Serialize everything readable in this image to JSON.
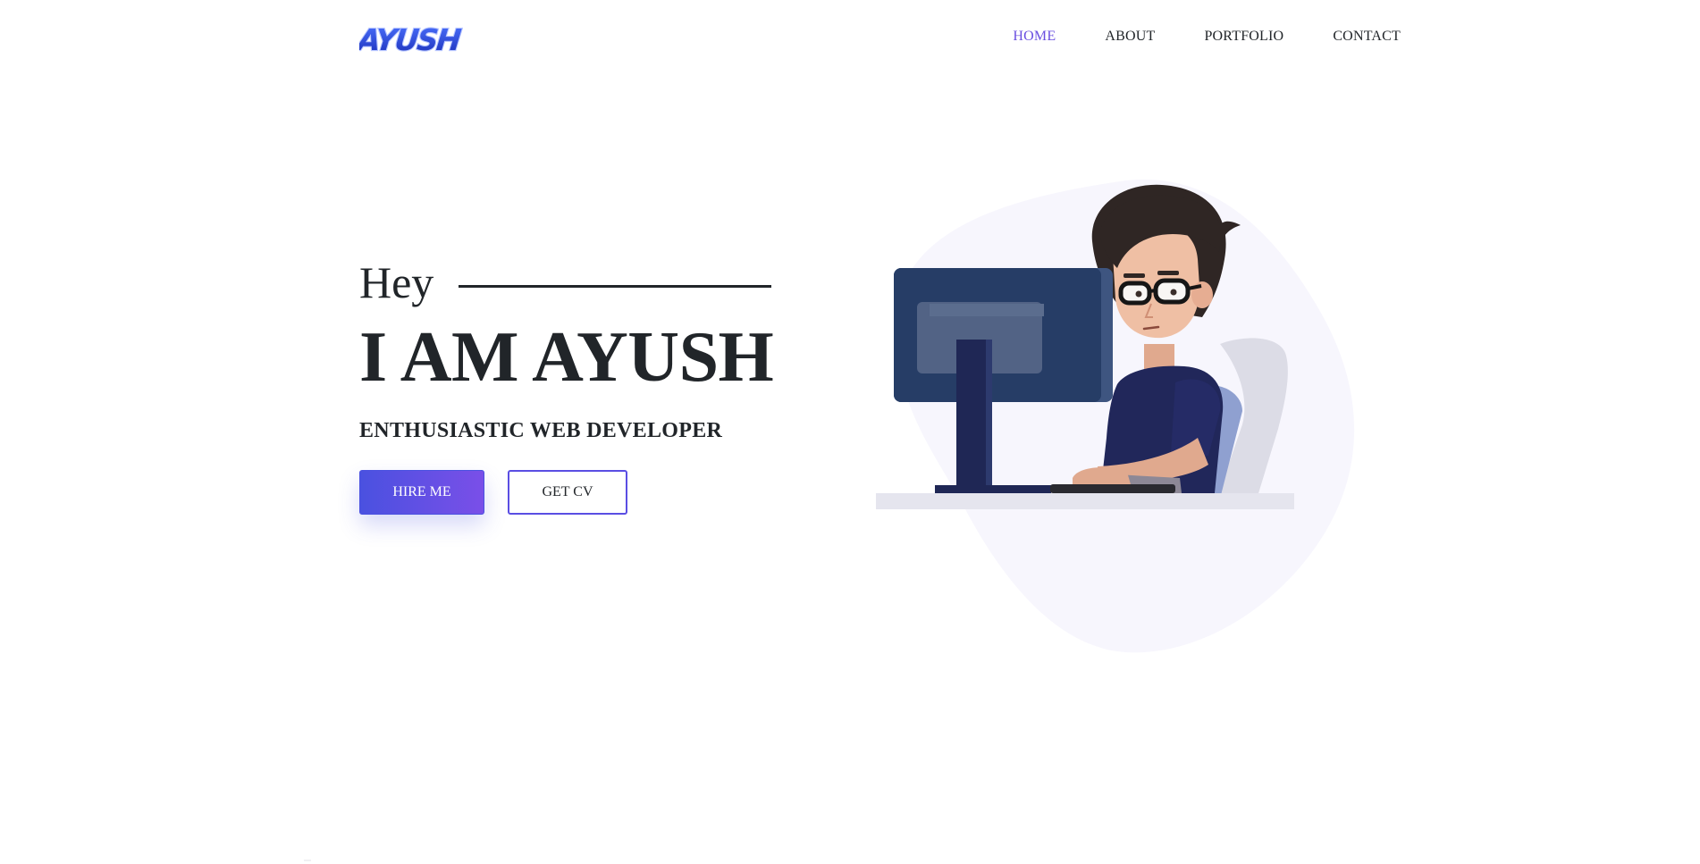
{
  "brand": {
    "logo_text": "AYUSH",
    "logo_icon": "brand-wordmark-logo"
  },
  "nav": {
    "items": [
      {
        "label": "HOME",
        "active": true
      },
      {
        "label": "ABOUT",
        "active": false
      },
      {
        "label": "PORTFOLIO",
        "active": false
      },
      {
        "label": "CONTACT",
        "active": false
      }
    ]
  },
  "hero": {
    "greeting": "Hey",
    "title": "I AM AYUSH",
    "subtitle": "ENTHUSIASTIC WEB DEVELOPER",
    "buttons": {
      "primary_label": "HIRE ME",
      "secondary_label": "GET CV"
    },
    "illustration_icon": "developer-at-computer-illustration"
  },
  "colors": {
    "accent": "#6a4fe0",
    "primary_gradient_start": "#4a51e0",
    "primary_gradient_end": "#7a4fe8",
    "text": "#212529",
    "blob": "#f7f6fd"
  }
}
